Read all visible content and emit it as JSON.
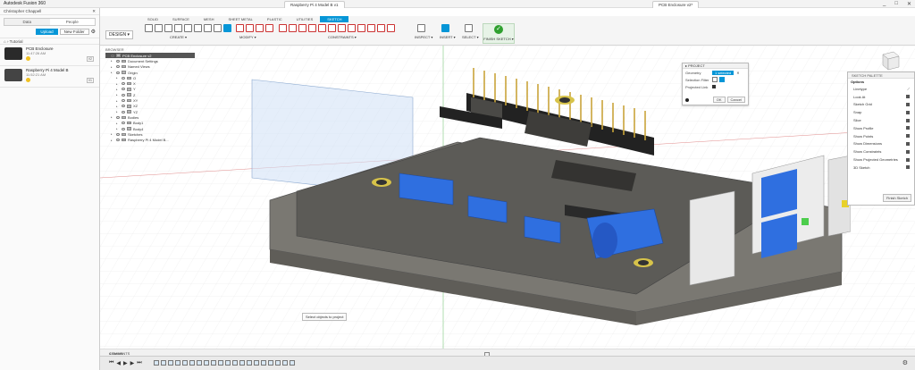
{
  "app": {
    "title": "Autodesk Fusion 360",
    "doc_tabs": [
      "Raspberry Pi 4 Model B v1",
      "PCB Enclosure v2*"
    ],
    "window_controls": [
      "_",
      "□",
      "✕"
    ]
  },
  "data_panel": {
    "user": "Christopher Chappell",
    "tabs": [
      "Data",
      "People"
    ],
    "upload_label": "Upload",
    "new_folder_label": "New Folder",
    "project": "Tutorial",
    "files": [
      {
        "name": "PCB Enclosure",
        "date": "11:47:26 AM",
        "version": "V2"
      },
      {
        "name": "Raspberry Pi 4 Model B",
        "date": "11:52:21 AM",
        "version": "V1"
      }
    ]
  },
  "toolbar": {
    "workspace_tabs": [
      "SOLID",
      "SURFACE",
      "MESH",
      "SHEET METAL",
      "PLASTIC",
      "UTILITIES",
      "SKETCH"
    ],
    "active_tab": "SKETCH",
    "design_label": "DESIGN ▾",
    "groups": [
      "CREATE ▾",
      "MODIFY ▾",
      "CONSTRAINTS ▾",
      "INSPECT ▾",
      "INSERT ▾",
      "SELECT ▾"
    ],
    "finish_sketch": "FINISH SKETCH ▾"
  },
  "browser": {
    "header": "BROWSER",
    "rows": [
      {
        "label": "PCB Enclosure v2",
        "level": 0,
        "selected": true
      },
      {
        "label": "Document Settings",
        "level": 1
      },
      {
        "label": "Named Views",
        "level": 1
      },
      {
        "label": "Origin",
        "level": 1
      },
      {
        "label": "O",
        "level": 2
      },
      {
        "label": "X",
        "level": 2
      },
      {
        "label": "Y",
        "level": 2
      },
      {
        "label": "Z",
        "level": 2
      },
      {
        "label": "XY",
        "level": 2
      },
      {
        "label": "XZ",
        "level": 2
      },
      {
        "label": "YZ",
        "level": 2
      },
      {
        "label": "Bodies",
        "level": 1
      },
      {
        "label": "Body1",
        "level": 2
      },
      {
        "label": "Body4",
        "level": 2
      },
      {
        "label": "Sketches",
        "level": 1
      },
      {
        "label": "Raspberry Pi 4 Model B...",
        "level": 1
      }
    ]
  },
  "project_dialog": {
    "title": "▸ PROJECT",
    "geometry_label": "Geometry",
    "geometry_value": "1 selected",
    "selection_filter_label": "Selection Filter",
    "projected_link_label": "Projected Link",
    "ok_label": "OK",
    "cancel_label": "Cancel"
  },
  "sketch_palette": {
    "title": "SKETCH PALETTE",
    "section": "Options",
    "linetype_label": "Linetype",
    "options": [
      "Look At",
      "Sketch Grid",
      "Snap",
      "Slice",
      "Show Profile",
      "Show Points",
      "Show Dimensions",
      "Show Constraints",
      "Show Projected Geometries",
      "3D Sketch"
    ],
    "finish_label": "Finish Sketch"
  },
  "tooltip": "Select objects to project",
  "bottom": {
    "comments_label": "COMMENTS",
    "bodies_count": "4 Bodies"
  },
  "icons": {
    "close": "close-icon",
    "gear": "gear-icon",
    "check": "check-icon"
  },
  "colors": {
    "accent": "#0696d7",
    "finish_green": "#2fa02f",
    "enclosure": "#6f6d68",
    "usb_blue": "#2f6fe0",
    "pcb": "#5a5a56"
  }
}
